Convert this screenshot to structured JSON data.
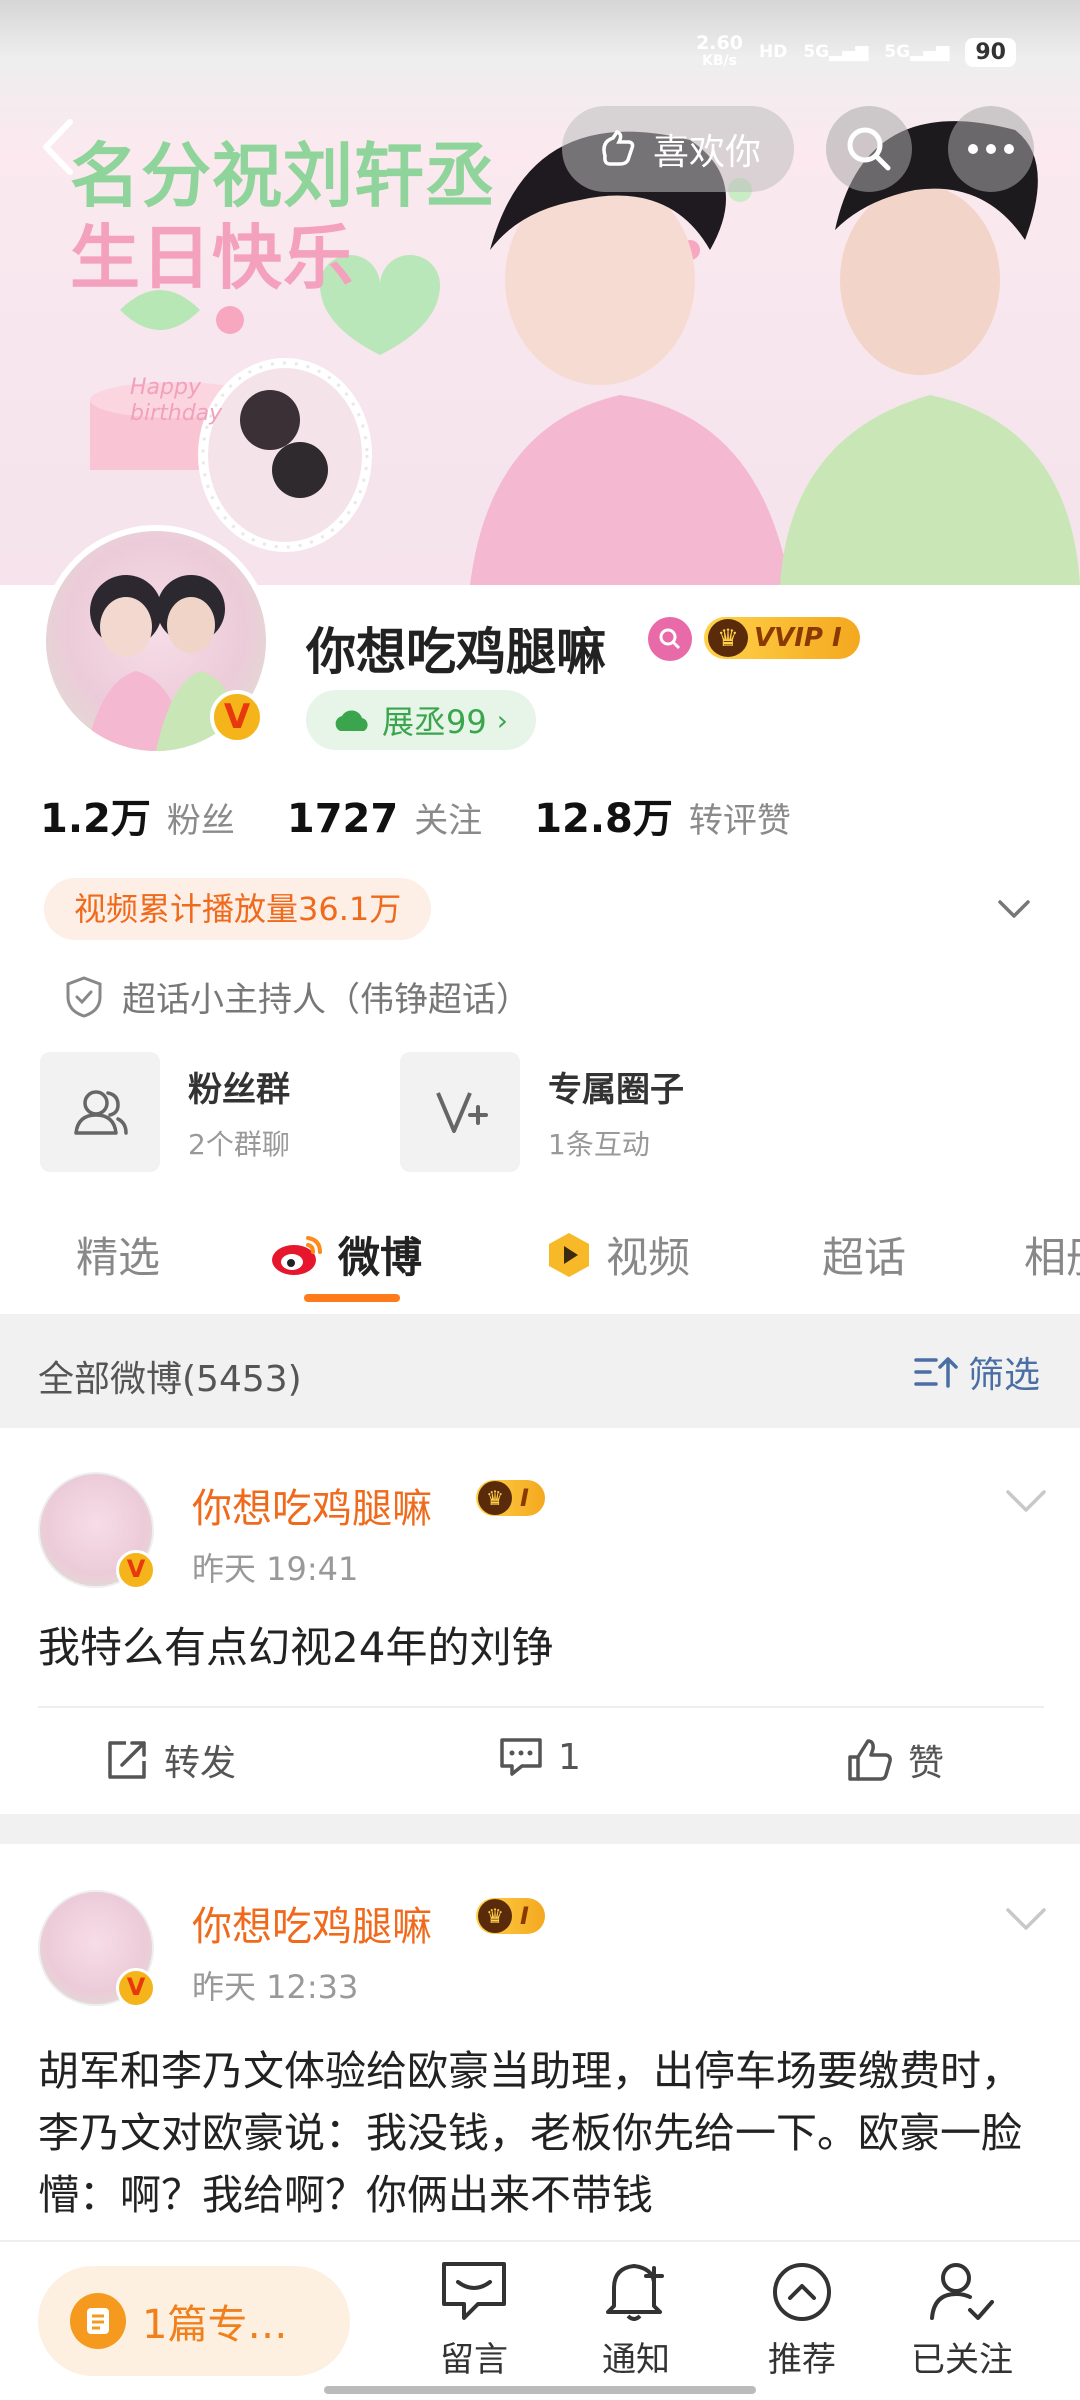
{
  "status_bar": {
    "speed_value": "2.60",
    "speed_unit": "KB/s",
    "hd": "HD",
    "sim1": "5G",
    "sim2": "5G",
    "battery": "90"
  },
  "banner": {
    "title_line1": "名分祝刘轩丞",
    "title_line2": "生日快乐",
    "happy_line1": "Happy",
    "happy_line2": "birthday",
    "like_label": "喜欢你"
  },
  "profile": {
    "username": "你想吃鸡腿嘛",
    "vip_label": "VVIP I",
    "group_chip": "展丞99",
    "stats": [
      {
        "num": "1.2万",
        "label": "粉丝"
      },
      {
        "num": "1727",
        "label": "关注"
      },
      {
        "num": "12.8万",
        "label": "转评赞"
      }
    ],
    "play_count": "视频累计播放量36.1万",
    "host_role": "超话小主持人（伟铮超话）",
    "cards": [
      {
        "title": "粉丝群",
        "sub": "2个群聊"
      },
      {
        "title": "专属圈子",
        "sub": "1条互动"
      }
    ]
  },
  "tabs": [
    "精选",
    "微博",
    "视频",
    "超话",
    "相册"
  ],
  "filter": {
    "count_label": "全部微博(5453)",
    "filter_label": "筛选"
  },
  "posts": [
    {
      "author": "你想吃鸡腿嘛",
      "badge": "I",
      "time": "昨天 19:41",
      "text": "我特么有点幻视24年的刘铮",
      "repost_label": "转发",
      "comment_count": "1",
      "like_label": "赞"
    },
    {
      "author": "你想吃鸡腿嘛",
      "badge": "I",
      "time": "昨天 12:33",
      "text": "胡军和李乃文体验给欧豪当助理，出停车场要缴费时，李乃文对欧豪说：我没钱，老板你先给一下。欧豪一脸懵：啊？我给啊？你俩出来不带钱"
    }
  ],
  "bottom_bar": {
    "column_label": "1篇专…",
    "nav": [
      "留言",
      "通知",
      "推荐",
      "已关注"
    ]
  },
  "colors": {
    "accent_orange": "#f06a1c",
    "green": "#3aa54c",
    "link_blue": "#4b6fa5",
    "vip_gold": "#f4a81f"
  }
}
